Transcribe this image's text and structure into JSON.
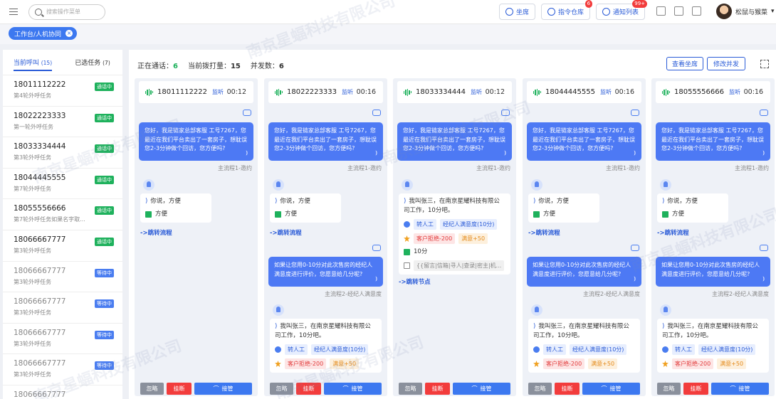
{
  "topbar": {
    "search_placeholder": "搜索操作菜单",
    "actions": [
      {
        "label": "坐席",
        "badge": ""
      },
      {
        "label": "指令仓库",
        "badge": "6"
      },
      {
        "label": "通知列表",
        "badge": "99+"
      }
    ],
    "user_name": "松鼠与猴菜"
  },
  "tabbar": {
    "active_tab": "工作台/人机协同"
  },
  "sidebar": {
    "tabs": [
      {
        "label": "当前呼叫",
        "count": "(15)"
      },
      {
        "label": "已选任务",
        "count": "(7)"
      }
    ],
    "items": [
      {
        "phone": "18011112222",
        "task": "第4轮外呼任务",
        "status": "通话中",
        "color": "green"
      },
      {
        "phone": "18022223333",
        "task": "第一轮外呼任务",
        "status": "通话中",
        "color": "green"
      },
      {
        "phone": "18033334444",
        "task": "第3轮外呼任务",
        "status": "通话中",
        "color": "green"
      },
      {
        "phone": "18044445555",
        "task": "第7轮外呼任务",
        "status": "通话中",
        "color": "green"
      },
      {
        "phone": "18055556666",
        "task": "第7轮外呼任务如果名字取...",
        "status": "通话中",
        "color": "green"
      },
      {
        "phone": "18066667777",
        "task": "第3轮外呼任务",
        "status": "通话中",
        "color": "green"
      },
      {
        "phone": "18066667777",
        "task": "第3轮外呼任务",
        "status": "等待中",
        "color": "blue"
      },
      {
        "phone": "18066667777",
        "task": "第3轮外呼任务",
        "status": "等待中",
        "color": "blue"
      },
      {
        "phone": "18066667777",
        "task": "第3轮外呼任务",
        "status": "等待中",
        "color": "blue"
      },
      {
        "phone": "18066667777",
        "task": "第3轮外呼任务",
        "status": "等待中",
        "color": "blue"
      },
      {
        "phone": "18066667777",
        "task": "",
        "status": "",
        "color": "blue"
      }
    ]
  },
  "stats": {
    "in_call_label": "正在通话：",
    "in_call": "6",
    "dialing_label": "当前拨打量：",
    "dialing": "15",
    "concurrency_label": "并发数：",
    "concurrency": "6",
    "view_seats": "查看坐席",
    "edit_concurrency": "修改并发"
  },
  "cards": [
    {
      "phone": "18011112222",
      "listen": "监听",
      "time": "00:12"
    },
    {
      "phone": "18022223333",
      "listen": "监听",
      "time": "00:16"
    },
    {
      "phone": "18033334444",
      "listen": "监听",
      "time": "00:12"
    },
    {
      "phone": "18044445555",
      "listen": "监听",
      "time": "00:16"
    },
    {
      "phone": "18055556666",
      "listen": "监听",
      "time": "00:16"
    }
  ],
  "dialog": {
    "greeting": "您好，我是链家总部客服 工号7267，您最近在我们平台卖出了一套房子，想耽误您2-3分钟做个回访，您方便吗?",
    "flow1": "主流程1-邀约",
    "reply1": "你说，方便",
    "intent1": "方便",
    "transfer_flow": "->跳转流程",
    "question2": "如果让您用0-10分对此次售房的经纪人满意度进行评价，您愿意给几分呢?",
    "flow2": "主流程2-经纪人满意度",
    "reply2": "我叫张三，在南京星耀科技有限公司工作，10分吧。",
    "tag_manual": "转人工",
    "tag_satisfaction": "经纪人满意度(10分)",
    "tag_reject": "客户拒绝-200",
    "tag_satisfied": "满意+50",
    "score": "10分",
    "entities": "{{留言|信箱|寻人|查录|密主|机...",
    "transfer_node": "->跳转节点"
  },
  "footer": {
    "ignore": "忽略",
    "hangup": "挂断",
    "takeover": "接管"
  },
  "watermark": "南京星蝠科技有限公司"
}
